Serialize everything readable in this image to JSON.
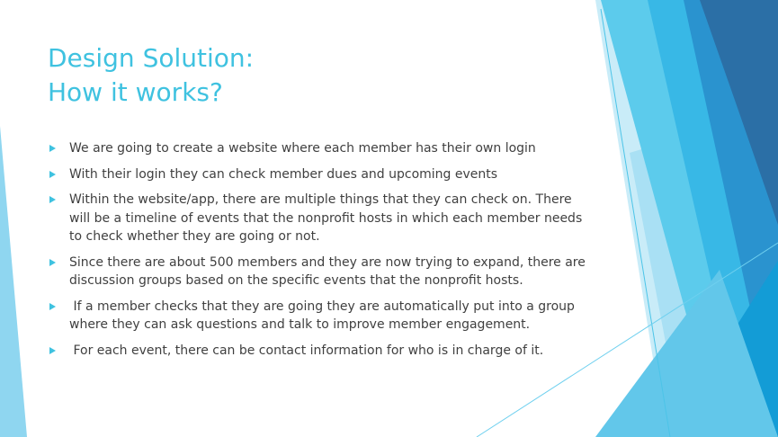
{
  "slide": {
    "title_line1": "Design Solution:",
    "title_line2": "How it works?",
    "bullets": [
      "We are going to create a website where each member has their own login",
      "With their login they can check member dues and upcoming events",
      "Within the website/app, there are multiple things that they can check on. There will be a timeline of events that the nonprofit hosts in which each member needs to check whether they are going or not.",
      "Since there are about 500 members and they are now trying to expand, there are discussion groups based on the specific events that the nonprofit hosts.",
      " If a member checks that they are going they are automatically put into a group where they can ask questions and talk to improve member engagement.",
      " For each event, there can be contact information for who is in charge of it."
    ]
  },
  "colors": {
    "accent": "#3fc2e0",
    "body_text": "#404040",
    "decor_light": "#d3eef8",
    "decor_mid": "#4cc4e8",
    "decor_deep": "#1b9dd4",
    "decor_dark": "#2a6ea5"
  },
  "icons": {
    "bullet": "triangle-bullet-icon"
  }
}
